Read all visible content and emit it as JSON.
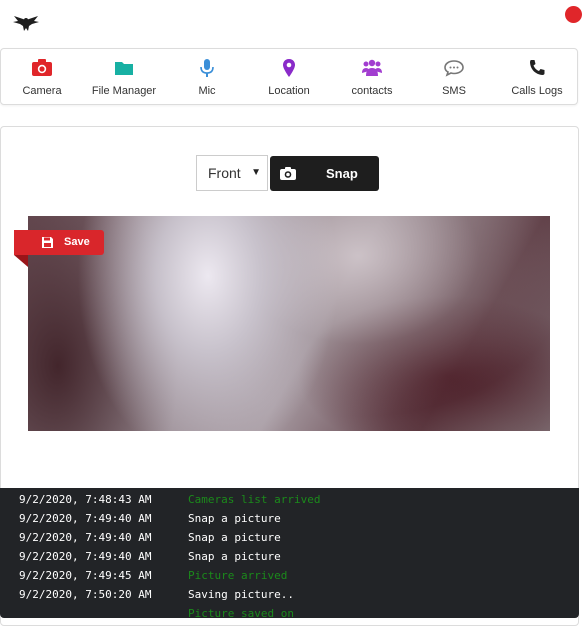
{
  "nav": {
    "items": [
      {
        "label": "Camera",
        "icon": "camera-icon",
        "color": "#e0262a"
      },
      {
        "label": "File Manager",
        "icon": "folder-icon",
        "color": "#17b0a3"
      },
      {
        "label": "Mic",
        "icon": "microphone-icon",
        "color": "#3b8fd8"
      },
      {
        "label": "Location",
        "icon": "map-pin-icon",
        "color": "#8a2bc9"
      },
      {
        "label": "contacts",
        "icon": "users-icon",
        "color": "#a23dd0"
      },
      {
        "label": "SMS",
        "icon": "chat-icon",
        "color": "#777777"
      },
      {
        "label": "Calls Logs",
        "icon": "phone-icon",
        "color": "#222222"
      }
    ]
  },
  "camera": {
    "selected": "Front",
    "snap_label": "Snap",
    "save_label": "Save"
  },
  "console": {
    "logs": [
      {
        "time": "9/2/2020, 7:48:43 AM",
        "message": "Cameras list arrived",
        "color": "green"
      },
      {
        "time": "9/2/2020, 7:49:40 AM",
        "message": "Snap a picture",
        "color": "white"
      },
      {
        "time": "9/2/2020, 7:49:40 AM",
        "message": "Snap a picture",
        "color": "white"
      },
      {
        "time": "9/2/2020, 7:49:40 AM",
        "message": "Snap a picture",
        "color": "white"
      },
      {
        "time": "9/2/2020, 7:49:45 AM",
        "message": "Picture arrived",
        "color": "green"
      },
      {
        "time": "9/2/2020, 7:50:20 AM",
        "message": "Saving picture..",
        "color": "white"
      },
      {
        "time": "",
        "message": "Picture saved on",
        "color": "green"
      }
    ]
  },
  "colors": {
    "accent": "#e0262a",
    "dark": "#1e1e1e",
    "console_bg": "#222427",
    "log_green": "#1b8a1b"
  }
}
